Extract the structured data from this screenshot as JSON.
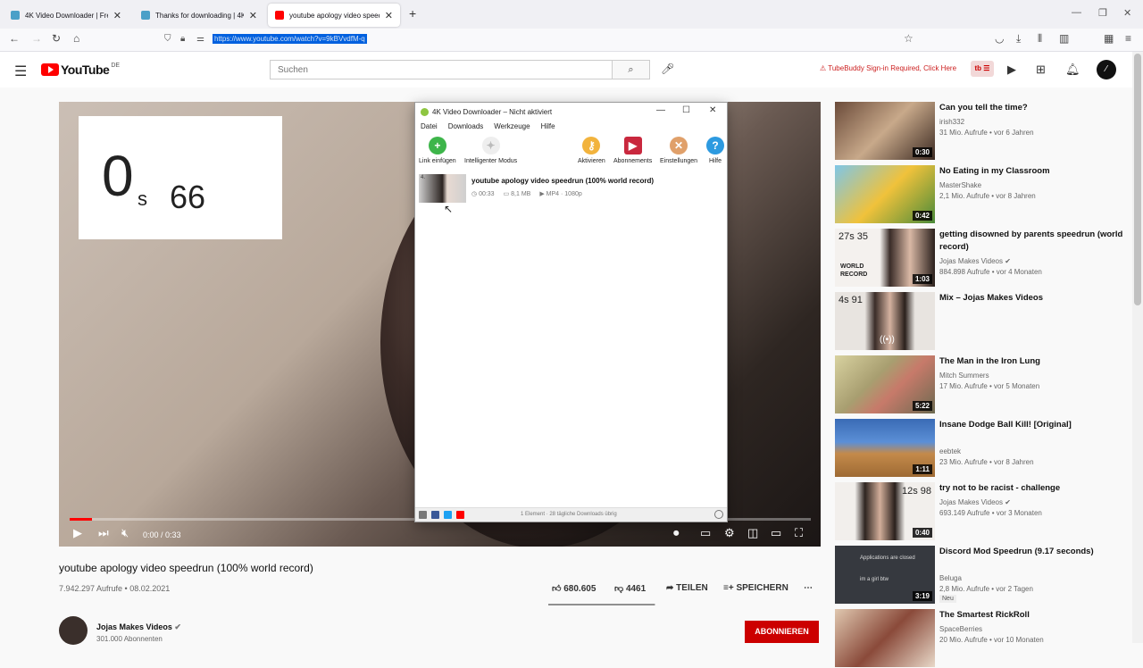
{
  "browser": {
    "tabs": [
      {
        "title": "4K Video Downloader | Free Vid",
        "icon": "downloader-favicon",
        "active": false
      },
      {
        "title": "Thanks for downloading | 4K Do",
        "icon": "downloader-favicon",
        "active": false
      },
      {
        "title": "youtube apology video speedr",
        "icon": "youtube-favicon",
        "active": true
      }
    ],
    "new_tab": "+",
    "url": "https://www.youtube.com/watch?v=9kBVvdfM-q"
  },
  "youtube": {
    "logo_text": "YouTube",
    "region": "DE",
    "search_placeholder": "Suchen",
    "tubebuddy_warning": "TubeBuddy Sign-in Required, Click Here",
    "tb_label": "tb",
    "notification_count": "10"
  },
  "player": {
    "timer_seconds": "0",
    "timer_unit": "s",
    "timer_ms": "66",
    "time_readout": "0:00 / 0:33",
    "progress": 0.03
  },
  "downloader": {
    "title": "4K Video Downloader – Nicht aktiviert",
    "menu": [
      "Datei",
      "Downloads",
      "Werkzeuge",
      "Hilfe"
    ],
    "tools": {
      "paste": "Link einfügen",
      "smart": "Intelligenter Modus",
      "activate": "Aktivieren",
      "subs": "Abonnements",
      "settings": "Einstellungen",
      "help": "Hilfe"
    },
    "item": {
      "thumb_label": "4.",
      "title": "youtube apology video speedrun (100% world record)",
      "duration": "00:33",
      "size": "8,1 MB",
      "format": "MP4 · 1080p"
    },
    "status": "1 Element · 28 tägliche Downloads übrig"
  },
  "video": {
    "title": "youtube apology video speedrun (100% world record)",
    "views_date": "7.942.297 Aufrufe • 08.02.2021",
    "likes": "680.605",
    "dislikes": "4461",
    "share": "TEILEN",
    "save": "SPEICHERN",
    "like_ratio": 0.99,
    "channel": "Jojas Makes Videos",
    "subscribers": "301.000 Abonnenten",
    "subscribe": "ABONNIEREN"
  },
  "recommendations": [
    {
      "title": "Can you tell the time?",
      "channel": "irish332",
      "stats": "31 Mio. Aufrufe • vor 6 Jahren",
      "duration": "0:30",
      "verified": false
    },
    {
      "title": "No Eating in my Classroom",
      "channel": "MasterShake",
      "stats": "2,1 Mio. Aufrufe • vor 8 Jahren",
      "duration": "0:42",
      "verified": false
    },
    {
      "title": "getting disowned by parents speedrun (world record)",
      "channel": "Jojas Makes Videos",
      "stats": "884.898 Aufrufe • vor 4 Monaten",
      "duration": "1:03",
      "verified": true,
      "thumb_text": "27s 35",
      "thumb_caption": "WORLD RECORD"
    },
    {
      "title": "Mix – Jojas Makes Videos",
      "channel": "",
      "stats": "",
      "duration": "",
      "verified": false,
      "thumb_text": "4s 91"
    },
    {
      "title": "The Man in the Iron Lung",
      "channel": "Mitch Summers",
      "stats": "17 Mio. Aufrufe • vor 5 Monaten",
      "duration": "5:22",
      "verified": false
    },
    {
      "title": "Insane Dodge Ball Kill! [Original]",
      "channel": "eebtek",
      "stats": "23 Mio. Aufrufe • vor 8 Jahren",
      "duration": "1:11",
      "verified": false
    },
    {
      "title": "try not to be racist - challenge",
      "channel": "Jojas Makes Videos",
      "stats": "693.149 Aufrufe • vor 3 Monaten",
      "duration": "0:40",
      "verified": true,
      "thumb_text": "12s 98"
    },
    {
      "title": "Discord Mod Speedrun (9.17 seconds)",
      "channel": "Beluga",
      "stats": "2,8 Mio. Aufrufe • vor 2 Tagen",
      "duration": "3:19",
      "verified": false,
      "badge": "Neu",
      "thumb_line1": "Applications are closed",
      "thumb_line2": "im a girl btw"
    },
    {
      "title": "The Smartest RickRoll",
      "channel": "SpaceBerries",
      "stats": "20 Mio. Aufrufe • vor 10 Monaten",
      "duration": "",
      "verified": false
    }
  ]
}
